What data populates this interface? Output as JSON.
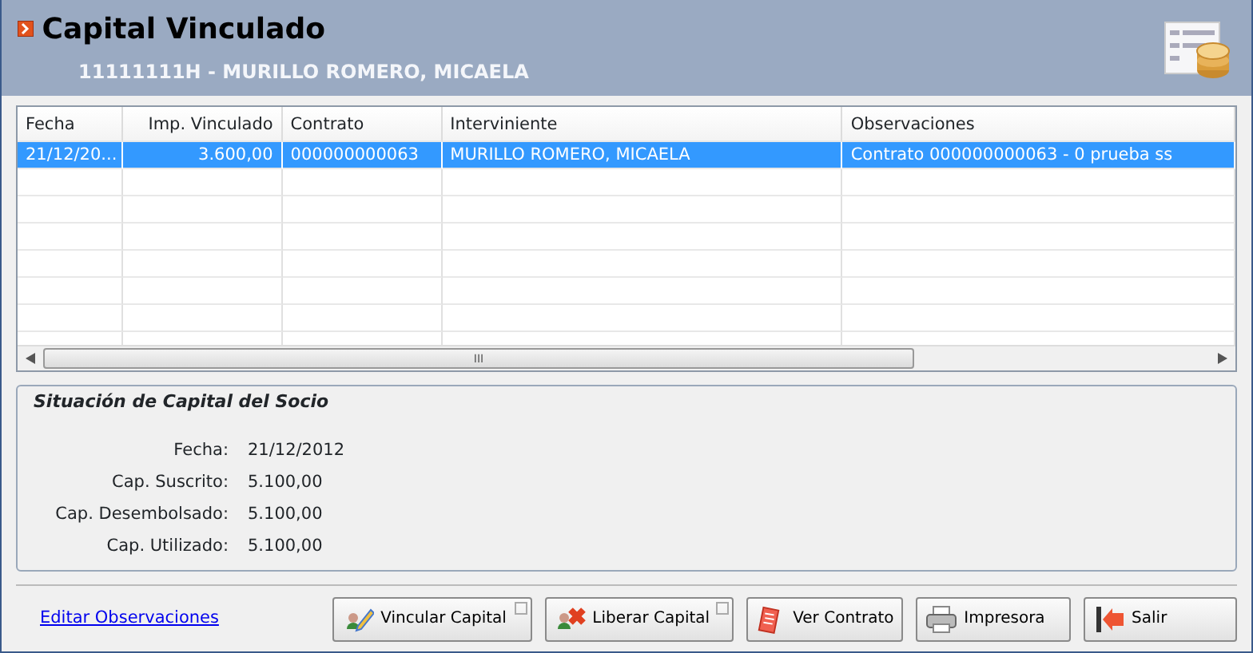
{
  "header": {
    "title": "Capital Vinculado",
    "subtitle": "11111111H - MURILLO ROMERO, MICAELA"
  },
  "table": {
    "columns": [
      {
        "label": "Fecha"
      },
      {
        "label": "Imp. Vinculado"
      },
      {
        "label": "Contrato"
      },
      {
        "label": "Interviniente"
      },
      {
        "label": "Observaciones"
      }
    ],
    "rows": [
      {
        "selected": true,
        "cells": [
          "21/12/20...",
          "3.600,00",
          "000000000063",
          "MURILLO ROMERO, MICAELA",
          "Contrato 000000000063 - 0  prueba ss"
        ]
      }
    ],
    "scrollbar_grip": "III"
  },
  "summary": {
    "title": "Situación de Capital del Socio",
    "fields": [
      {
        "label": "Fecha:",
        "value": "21/12/2012"
      },
      {
        "label": "Cap. Suscrito:",
        "value": "5.100,00"
      },
      {
        "label": "Cap. Desembolsado:",
        "value": "5.100,00"
      },
      {
        "label": "Cap. Utilizado:",
        "value": "5.100,00"
      }
    ]
  },
  "link": "Editar Observaciones",
  "buttons": [
    {
      "label": "Vincular Capital",
      "tag_mark": true
    },
    {
      "label": "Liberar Capital",
      "tag_mark": true
    },
    {
      "label": "Ver Contrato",
      "tag_mark": false
    },
    {
      "label": "Impresora",
      "tag_mark": false
    },
    {
      "label": "Salir",
      "tag_mark": false
    }
  ]
}
